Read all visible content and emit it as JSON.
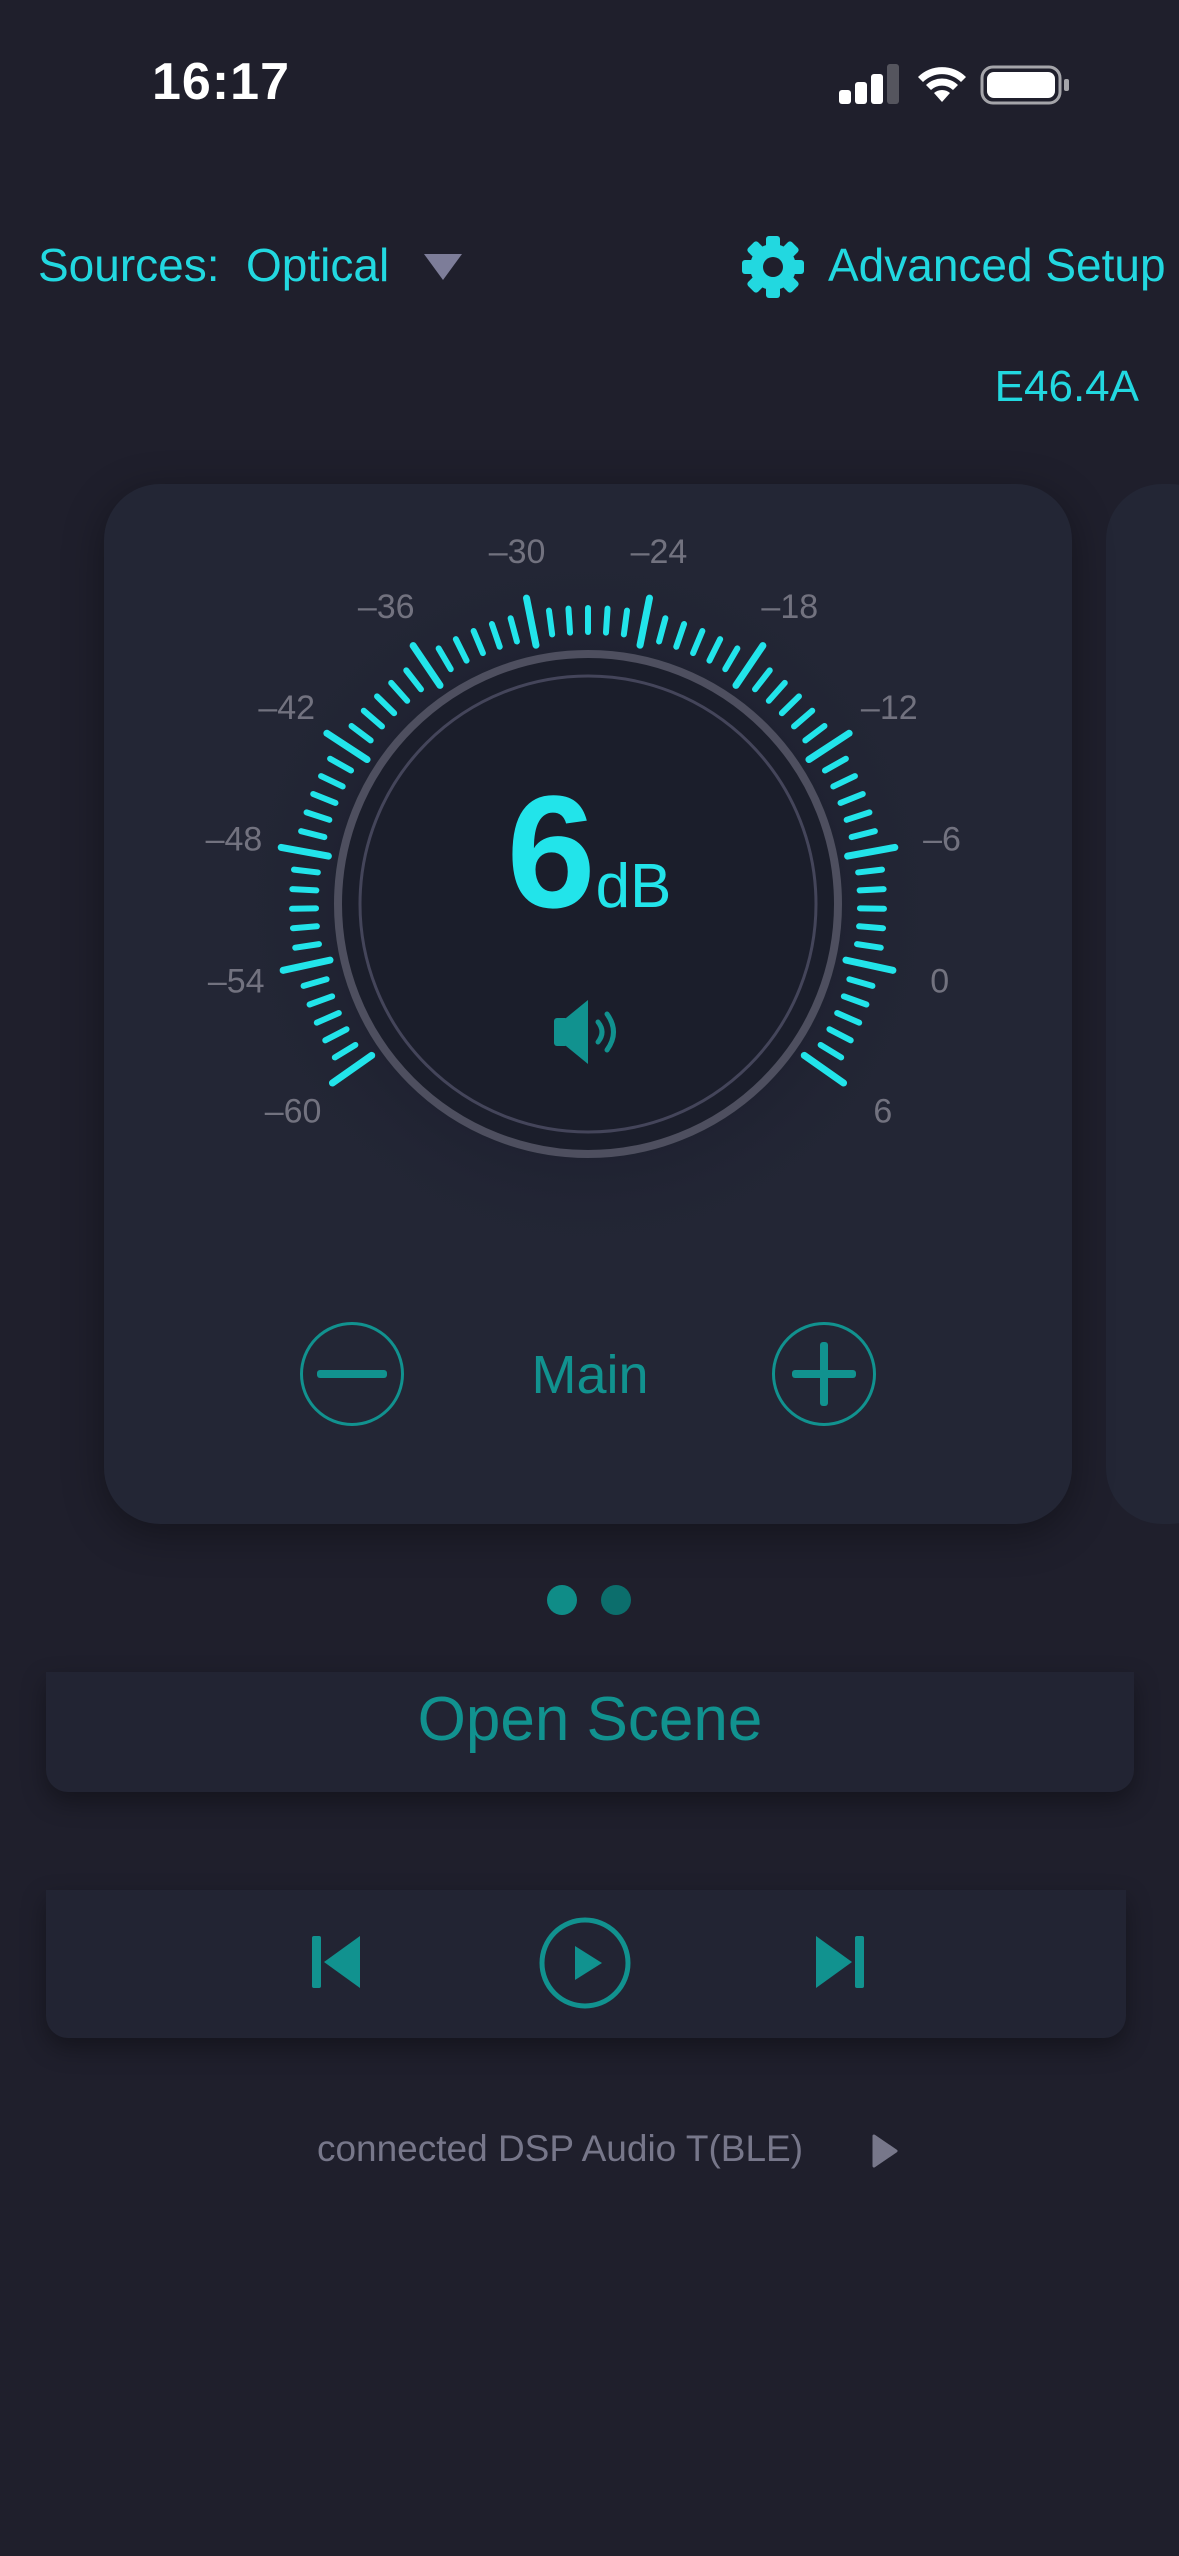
{
  "status_bar": {
    "time": "16:17"
  },
  "header": {
    "sources_label": "Sources:",
    "source_value": "Optical",
    "advanced_label": "Advanced Setup",
    "device_code": "E46.4A"
  },
  "volume": {
    "value": "6",
    "unit": "dB",
    "channel": "Main",
    "scale_labels": [
      "-60",
      "-54",
      "-48",
      "-42",
      "-36",
      "-30",
      "-24",
      "-18",
      "-12",
      "-6",
      "0",
      "6"
    ],
    "level_fraction": 1.0
  },
  "pager": {
    "pages": 2,
    "active": 0
  },
  "scene": {
    "label": "Open Scene"
  },
  "connection": {
    "text": "connected DSP Audio T(BLE)"
  },
  "colors": {
    "background": "#1f1f2c",
    "accent": "#22d8e0",
    "teal": "#11928f",
    "muted": "#72727f"
  },
  "icons": [
    "signal-icon",
    "wifi-icon",
    "battery-icon",
    "dropdown-icon",
    "gear-icon",
    "speaker-icon",
    "minus-icon",
    "plus-icon",
    "previous-icon",
    "play-icon",
    "next-icon",
    "arrow-right-icon"
  ]
}
